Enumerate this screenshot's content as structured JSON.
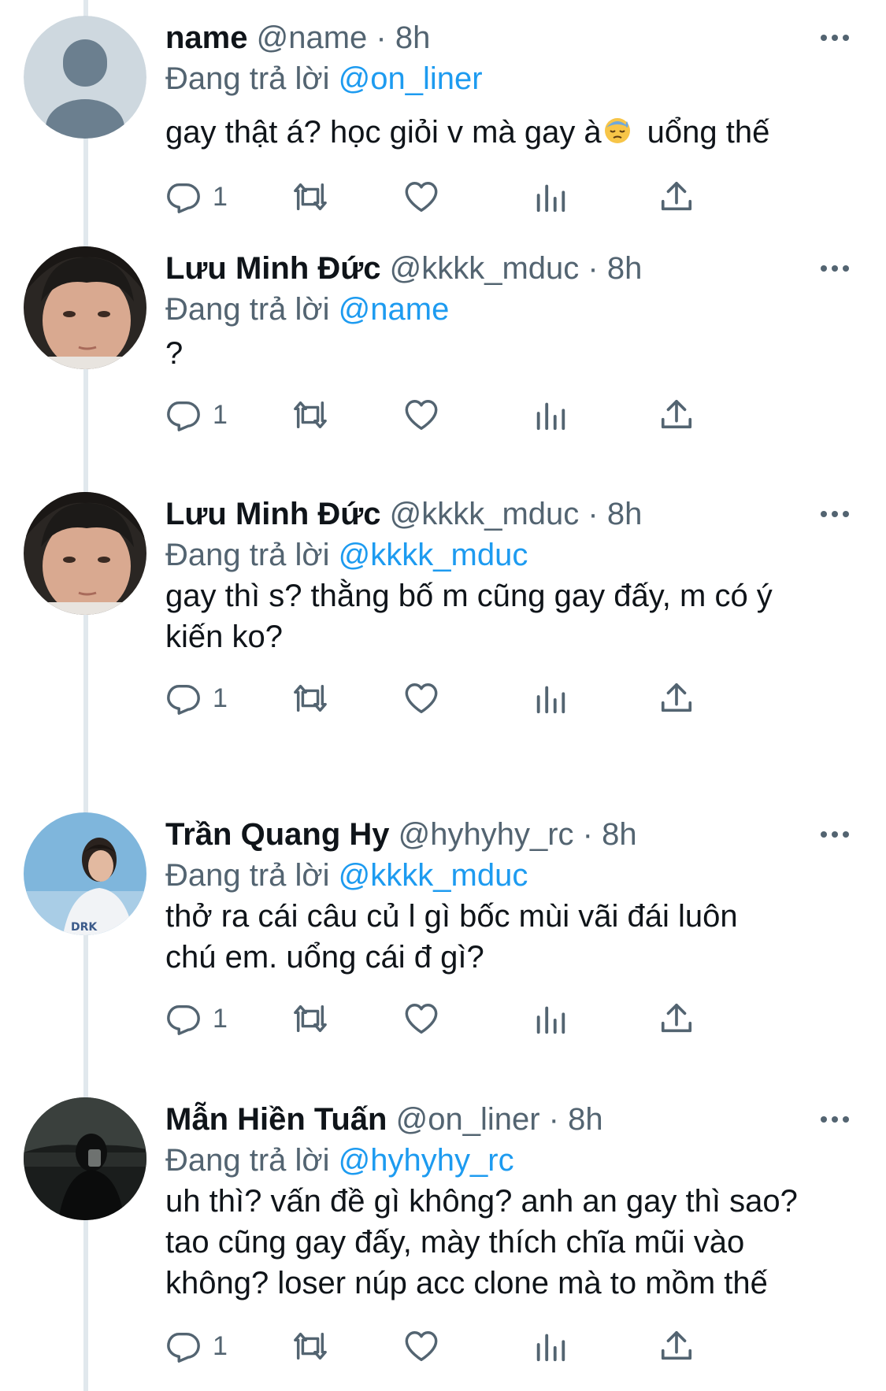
{
  "tweets": [
    {
      "display_name": "name",
      "handle": "@name",
      "separator": "·",
      "time": "8h",
      "reply_prefix": "Đang trả lời",
      "reply_to": "@on_liner",
      "text_before_emoji": "gay thật á? học giỏi v mà gay à",
      "text_after_emoji": "uổng thế",
      "reply_count": "1",
      "avatar": "default-avatar"
    },
    {
      "display_name": "Lưu Minh Đức",
      "handle": "@kkkk_mduc",
      "separator": "·",
      "time": "8h",
      "reply_prefix": "Đang trả lời",
      "reply_to": "@name",
      "text": "?",
      "reply_count": "1",
      "avatar": "photo-face"
    },
    {
      "display_name": "Lưu Minh Đức",
      "handle": "@kkkk_mduc",
      "separator": "·",
      "time": "8h",
      "reply_prefix": "Đang trả lời",
      "reply_to": "@kkkk_mduc",
      "text": "gay thì s? thằng bố m cũng gay đấy, m có ý\nkiến ko?",
      "reply_count": "1",
      "avatar": "photo-face"
    },
    {
      "display_name": "Trần Quang Hy",
      "handle": "@hyhyhy_rc",
      "separator": "·",
      "time": "8h",
      "reply_prefix": "Đang trả lời",
      "reply_to": "@kkkk_mduc",
      "text": "thở ra cái câu củ l gì bốc mùi vãi đái luôn\nchú em. uổng cái đ gì?",
      "reply_count": "1",
      "avatar": "photo-sky"
    },
    {
      "display_name": "Mẫn Hiền Tuấn",
      "handle": "@on_liner",
      "separator": "·",
      "time": "8h",
      "reply_prefix": "Đang trả lời",
      "reply_to": "@hyhyhy_rc",
      "text": "uh thì? vấn đề gì không? anh an gay thì sao?\ntao cũng gay đấy, mày thích chĩa mũi vào\nkhông? loser núp acc clone mà to mồm thế",
      "reply_count": "1",
      "avatar": "photo-dark"
    }
  ],
  "icons": {
    "reply": "reply-icon",
    "retweet": "retweet-icon",
    "like": "heart-icon",
    "views": "analytics-icon",
    "share": "share-icon",
    "more": "more-icon"
  },
  "colors": {
    "link": "#1d9bf0",
    "secondary_text": "#536471",
    "primary_text": "#0f1419",
    "thread_line": "#e1e8ed"
  }
}
